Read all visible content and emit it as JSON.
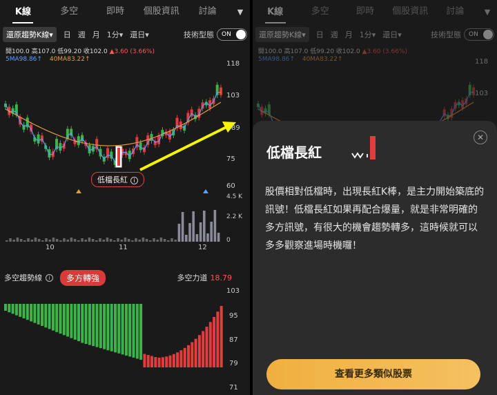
{
  "tabs": [
    "K線",
    "多空",
    "即時",
    "個股資訊",
    "討論"
  ],
  "toolbar": {
    "kline_type": "還原趨勢K線▾",
    "periods": [
      "日",
      "週",
      "月",
      "1分▾",
      "還日▾"
    ],
    "tech_label": "技術型態",
    "toggle": "ON"
  },
  "ohlc": {
    "open": "開100.0",
    "high": "高107.0",
    "low": "低99.20",
    "close": "收102.0",
    "change": "▲3.60 (3.66%)"
  },
  "ma": {
    "ma5": "5MA98.86↑",
    "ma40": "40MA83.22↑"
  },
  "price_axis": [
    "118",
    "103",
    "89",
    "75",
    "60"
  ],
  "vol_axis": [
    "4.5 K",
    "2.2 K",
    "0"
  ],
  "x_axis": [
    "10",
    "11",
    "12"
  ],
  "pattern_badge": "低檔長紅",
  "trend": {
    "label": "多空趨勢線",
    "badge": "多方轉強",
    "force_label": "多空力道",
    "force_value": "18.79",
    "axis": [
      "103",
      "95",
      "87",
      "79",
      "71"
    ]
  },
  "sheet": {
    "title": "低檔長紅",
    "body": "股價相對低檔時，出現長紅K棒，是主力開始築底的訊號！低檔長紅如果再配合爆量，就是非常明確的多方訊號，有很大的機會趨勢轉多，這時候就可以多多觀察進場時機囉！",
    "cta": "查看更多類似股票"
  },
  "colors": {
    "up": "#e23c3c",
    "down": "#3bb54a",
    "ma5": "#5aa0ff",
    "ma40": "#e89a3a",
    "arrow": "#f5f500"
  }
}
